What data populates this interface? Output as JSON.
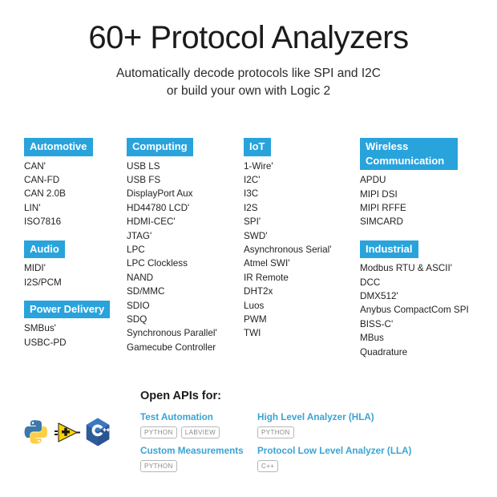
{
  "header": {
    "title": "60+ Protocol Analyzers",
    "subtitle_line1": "Automatically decode protocols like SPI and I2C",
    "subtitle_line2": "or build your own with Logic 2"
  },
  "colors": {
    "badge_blue": "#29a3dc",
    "link_blue": "#3aa3d5",
    "text_dark": "#231f20",
    "tag_gray": "#8a8a8a",
    "background": "#ffffff"
  },
  "columns": [
    {
      "groups": [
        {
          "badge": "Automotive",
          "items": [
            "CAN'",
            "CAN-FD",
            "CAN 2.0B",
            "LIN'",
            "ISO7816"
          ]
        },
        {
          "badge": "Audio",
          "items": [
            "MIDI'",
            "I2S/PCM"
          ]
        },
        {
          "badge": "Power Delivery",
          "items": [
            "SMBus'",
            "USBC-PD"
          ]
        }
      ]
    },
    {
      "groups": [
        {
          "badge": "Computing",
          "items": [
            "USB LS",
            "USB FS",
            "DisplayPort Aux",
            "HD44780 LCD'",
            "HDMI-CEC'",
            "JTAG'",
            "LPC",
            "LPC Clockless",
            "NAND",
            "SD/MMC",
            "SDIO",
            "SDQ",
            "Synchronous Parallel'",
            "Gamecube Controller"
          ]
        }
      ]
    },
    {
      "groups": [
        {
          "badge": "IoT",
          "items": [
            "1-Wire'",
            "I2C'",
            "I3C",
            "I2S",
            "SPI'",
            "SWD'",
            "Asynchronous Serial'",
            "Atmel SWI'",
            "IR Remote",
            "DHT2x",
            "Luos",
            "PWM",
            "TWI"
          ]
        }
      ]
    },
    {
      "groups": [
        {
          "badge": "Wireless Communication",
          "items": [
            "APDU",
            "MIPI DSI",
            "MIPI RFFE",
            "SIMCARD"
          ]
        },
        {
          "badge": "Industrial",
          "items": [
            "Modbus RTU & ASCII'",
            "DCC",
            "DMX512'",
            "Anybus CompactCom SPI",
            "BISS-C'",
            "MBus",
            "Quadrature"
          ]
        }
      ]
    }
  ],
  "apis": {
    "heading": "Open APIs for:",
    "logos": [
      "python-logo",
      "labview-logo",
      "cplusplus-logo"
    ],
    "entries": [
      {
        "label": "Test Automation",
        "tags": [
          "PYTHON",
          "LABVIEW"
        ]
      },
      {
        "label": "High Level Analyzer (HLA)",
        "tags": [
          "PYTHON"
        ]
      },
      {
        "label": "Custom Measurements",
        "tags": [
          "PYTHON"
        ]
      },
      {
        "label": "Protocol Low Level Analyzer (LLA)",
        "tags": [
          "C++"
        ]
      }
    ]
  }
}
